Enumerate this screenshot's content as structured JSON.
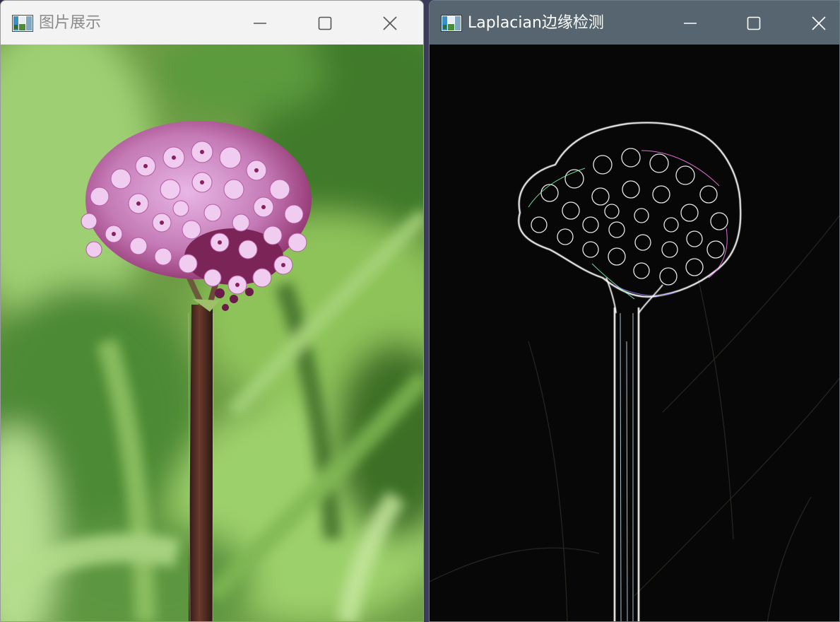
{
  "windows": [
    {
      "title": "图片展示",
      "icon": "opencv-window-icon",
      "image": "verbena-flower-photo",
      "controls": [
        "minimize-icon",
        "maximize-icon",
        "close-icon"
      ],
      "theme": {
        "titlebar": "#f3f3f3",
        "title_text": "#8a8a8a",
        "glyph": "#555555"
      }
    },
    {
      "title": "Laplacian边缘检测",
      "icon": "opencv-window-icon",
      "image": "laplacian-edge-map",
      "controls": [
        "minimize-icon",
        "maximize-icon",
        "close-icon"
      ],
      "theme": {
        "titlebar": "#56656f",
        "title_text": "#ffffff",
        "glyph": "#ffffff"
      }
    }
  ]
}
